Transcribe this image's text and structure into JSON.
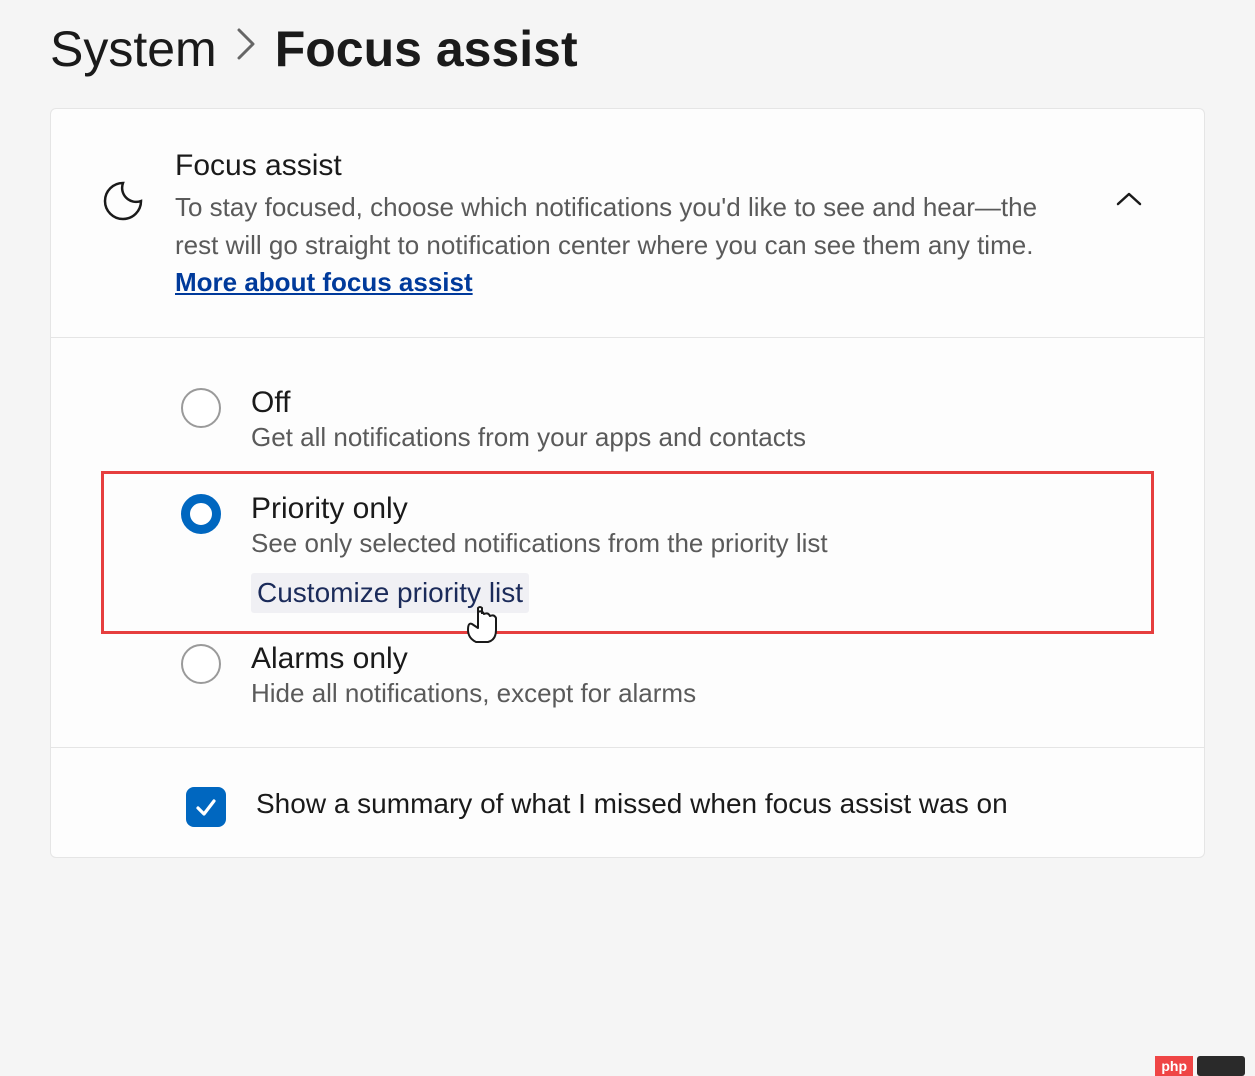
{
  "breadcrumb": {
    "parent": "System",
    "current": "Focus assist"
  },
  "header": {
    "title": "Focus assist",
    "description_pre": "To stay focused, choose which notifications you'd like to see and hear—the rest will go straight to notification center where you can see them any time.  ",
    "link_text": "More about focus assist"
  },
  "options": {
    "off": {
      "title": "Off",
      "desc": "Get all notifications from your apps and contacts",
      "selected": false
    },
    "priority": {
      "title": "Priority only",
      "desc": "See only selected notifications from the priority list",
      "sublink": "Customize priority list",
      "selected": true,
      "highlighted": true
    },
    "alarms": {
      "title": "Alarms only",
      "desc": "Hide all notifications, except for alarms",
      "selected": false
    }
  },
  "summary_checkbox": {
    "checked": true,
    "label": "Show a summary of what I missed when focus assist was on"
  },
  "watermark": {
    "text": "php"
  }
}
